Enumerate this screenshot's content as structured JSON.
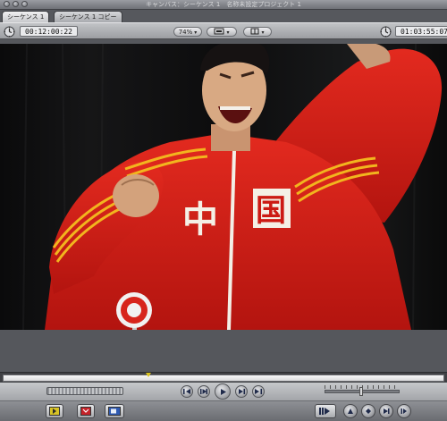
{
  "window": {
    "title": "キャンバス：シーケンス 1　名称未設定プロジェクト 1"
  },
  "tabs": [
    {
      "label": "シーケンス 1"
    },
    {
      "label": "シーケンス 1 コピー"
    }
  ],
  "toolbar": {
    "timecode_duration": "00:12:00:22",
    "zoom": "74%",
    "timecode_current": "01:03:55:07"
  },
  "jacket": {
    "characters": [
      "中",
      "国"
    ]
  },
  "playhead_position": 0.33,
  "colors": {
    "jacket": "#d61f17",
    "stripes": "#f2b51e",
    "background": "#0b0b0c"
  }
}
